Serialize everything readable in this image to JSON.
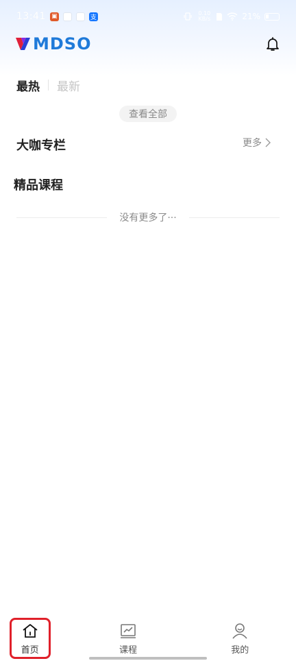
{
  "status_bar": {
    "time": "13:41",
    "network_speed": "0.10 KB/s",
    "battery": "21%"
  },
  "header": {
    "logo_text": "MDSO"
  },
  "tabs": [
    {
      "label": "最热"
    },
    {
      "label": "最新"
    }
  ],
  "view_all_label": "查看全部",
  "sections": {
    "columns_title": "大咖专栏",
    "columns_more": "更多",
    "courses_title": "精品课程"
  },
  "no_more_text": "没有更多了···",
  "bottom_nav": [
    {
      "label": "首页",
      "icon": "home-icon"
    },
    {
      "label": "课程",
      "icon": "course-chart-icon"
    },
    {
      "label": "我的",
      "icon": "profile-icon"
    }
  ],
  "colors": {
    "brand": "#1f7ad9",
    "logo_accent": "#e0203a",
    "highlight_outline": "#e0202a"
  }
}
